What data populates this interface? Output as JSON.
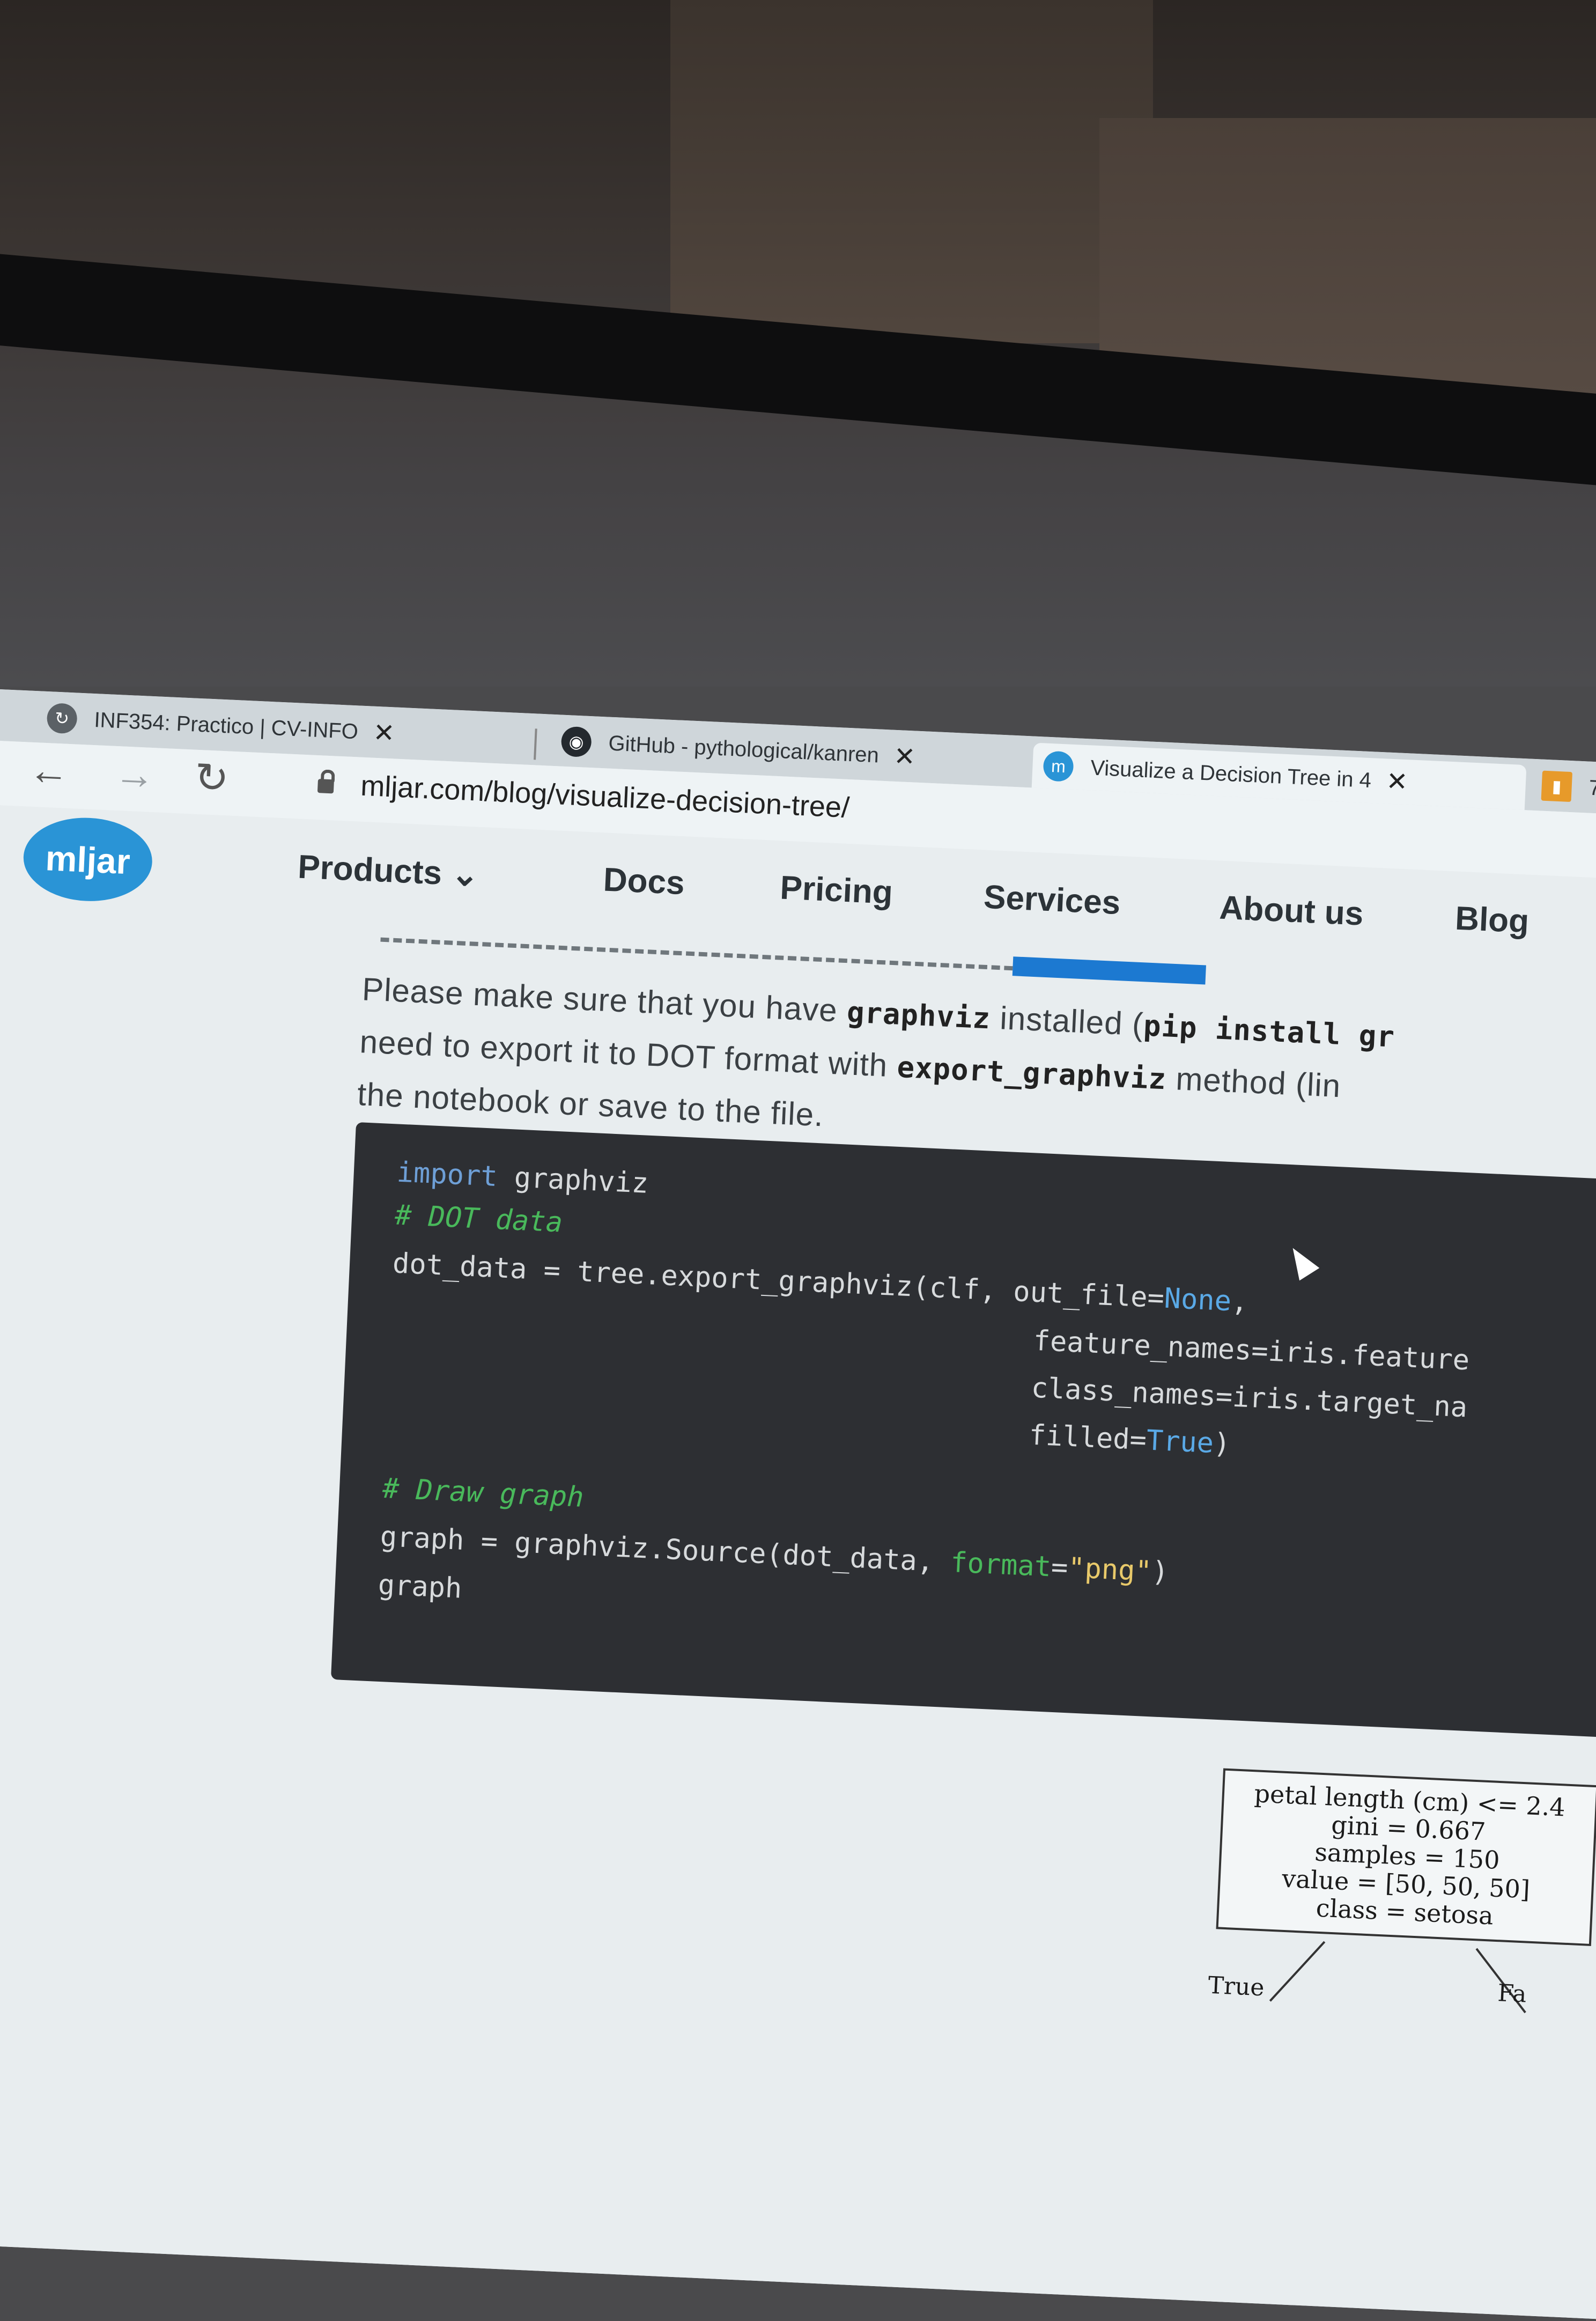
{
  "browser": {
    "tabs": [
      {
        "title": "INF354: Practico | CV-INFO",
        "favicon": "moodle-icon"
      },
      {
        "title": "GitHub - pythological/kanren",
        "favicon": "github-icon"
      },
      {
        "title": "Visualize a Decision Tree in 4",
        "favicon": "mljar-icon"
      },
      {
        "title": "7",
        "favicon": "chart-icon"
      }
    ],
    "active_tab": 2,
    "url": "mljar.com/blog/visualize-decision-tree/"
  },
  "site": {
    "logo": "mljar",
    "nav": [
      "Products",
      "Docs",
      "Pricing",
      "Services",
      "About us",
      "Blog"
    ],
    "nav_products_chevron": "⌄"
  },
  "article": {
    "para_line1_a": "Please make sure that you have ",
    "para_line1_code": "graphviz",
    "para_line1_b": " installed (",
    "para_line1_code2": "pip install gr",
    "para_line2_a": "need to export it to DOT format with ",
    "para_line2_code": "export_graphviz",
    "para_line2_b": " method (lin",
    "para_line3": "the notebook or save to the file."
  },
  "code": {
    "l1_kw": "import",
    "l1_rest": " graphviz",
    "l2": "# DOT data",
    "l3_a": "dot_data = tree.export_graphviz(clf, out_file=",
    "l3_none": "None",
    "l3_end": ",",
    "l4": "feature_names=iris.feature",
    "l5": "class_names=iris.target_na",
    "l6_a": "filled=",
    "l6_true": "True",
    "l6_end": ")",
    "l7": "# Draw graph",
    "l8_a": "graph = graphviz.Source(dot_data, ",
    "l8_kw": "format",
    "l8_eq": "=",
    "l8_str": "\"png\"",
    "l8_end": ")",
    "l9": "graph"
  },
  "tree": {
    "line1": "petal length (cm) <= 2.4",
    "line2": "gini = 0.667",
    "line3": "samples = 150",
    "line4": "value = [50, 50, 50]",
    "line5": "class = setosa",
    "edge_true": "True",
    "edge_false": "Fa"
  },
  "colors": {
    "brand": "#2a94d6",
    "code_bg": "#2d2f33",
    "comment": "#49b95b",
    "keyword": "#6e9fd6"
  }
}
